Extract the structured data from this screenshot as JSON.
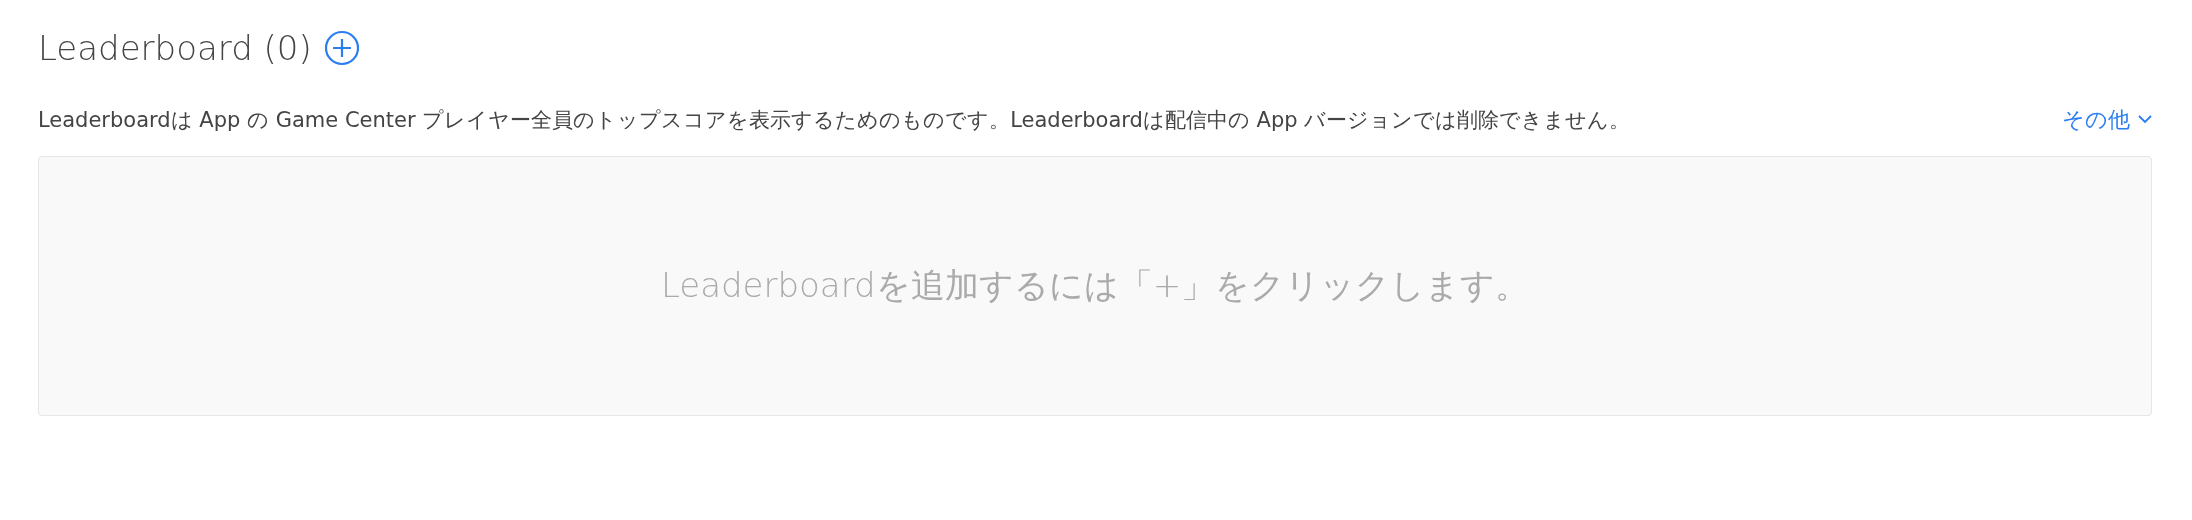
{
  "section": {
    "title": "Leaderboard (0)",
    "description": "Leaderboardは App の Game Center プレイヤー全員のトップスコアを表示するためのものです。Leaderboardは配信中の App バージョンでは削除できません。",
    "more_link": "その他",
    "empty_message": "Leaderboardを追加するには「+」をクリックします。"
  }
}
